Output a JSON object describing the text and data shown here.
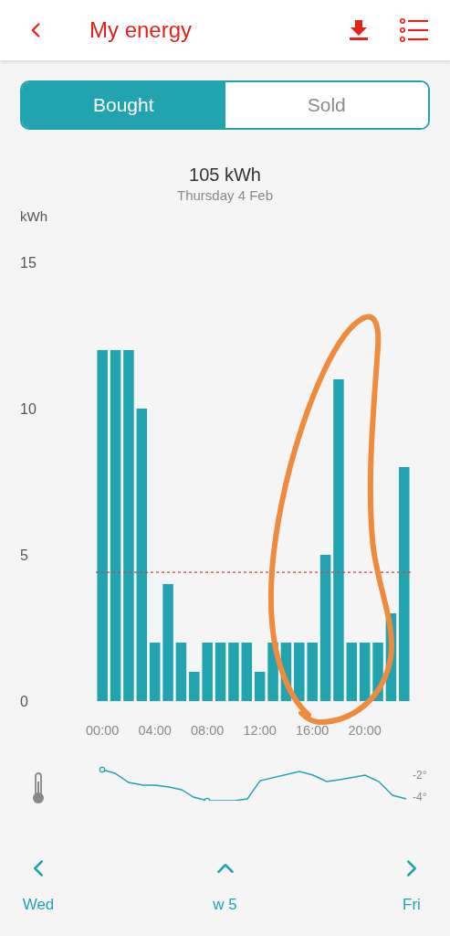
{
  "header": {
    "title": "My energy"
  },
  "tabs": [
    {
      "label": "Bought",
      "selected": true
    },
    {
      "label": "Sold",
      "selected": false
    }
  ],
  "summary": {
    "total": "105 kWh",
    "date": "Thursday 4 Feb"
  },
  "chart": {
    "chart_data": {
      "type": "bar",
      "ylabel": "kWh",
      "x": [
        0,
        1,
        2,
        3,
        4,
        5,
        6,
        7,
        8,
        9,
        10,
        11,
        12,
        13,
        14,
        15,
        16,
        17,
        18,
        19,
        20,
        21,
        22,
        23
      ],
      "series": [
        {
          "color": "#21a3b0",
          "values": [
            12,
            12,
            12,
            10,
            2,
            4,
            2,
            1,
            2,
            2,
            2,
            2,
            1,
            2,
            2,
            2,
            2,
            5,
            11,
            2,
            2,
            2,
            3,
            8
          ]
        }
      ],
      "xlim": [
        -0.5,
        23.5
      ],
      "ylim": [
        0,
        15
      ],
      "yticks": [
        0,
        5,
        10,
        15
      ],
      "xticks": [
        {
          "value": 0,
          "label": "00:00"
        },
        {
          "value": 4,
          "label": "04:00"
        },
        {
          "value": 8,
          "label": "08:00"
        },
        {
          "value": 12,
          "label": "12:00"
        },
        {
          "value": 16,
          "label": "16:00"
        },
        {
          "value": 20,
          "label": "20:00"
        }
      ],
      "ref_lines": [
        {
          "axis": "y",
          "value": 4.4,
          "color": "#d0404a"
        }
      ]
    }
  },
  "temperature": {
    "labels": [
      "-2°",
      "-4°"
    ]
  },
  "nav": {
    "previous": "Wed",
    "current": "w 5",
    "next": "Fri"
  }
}
